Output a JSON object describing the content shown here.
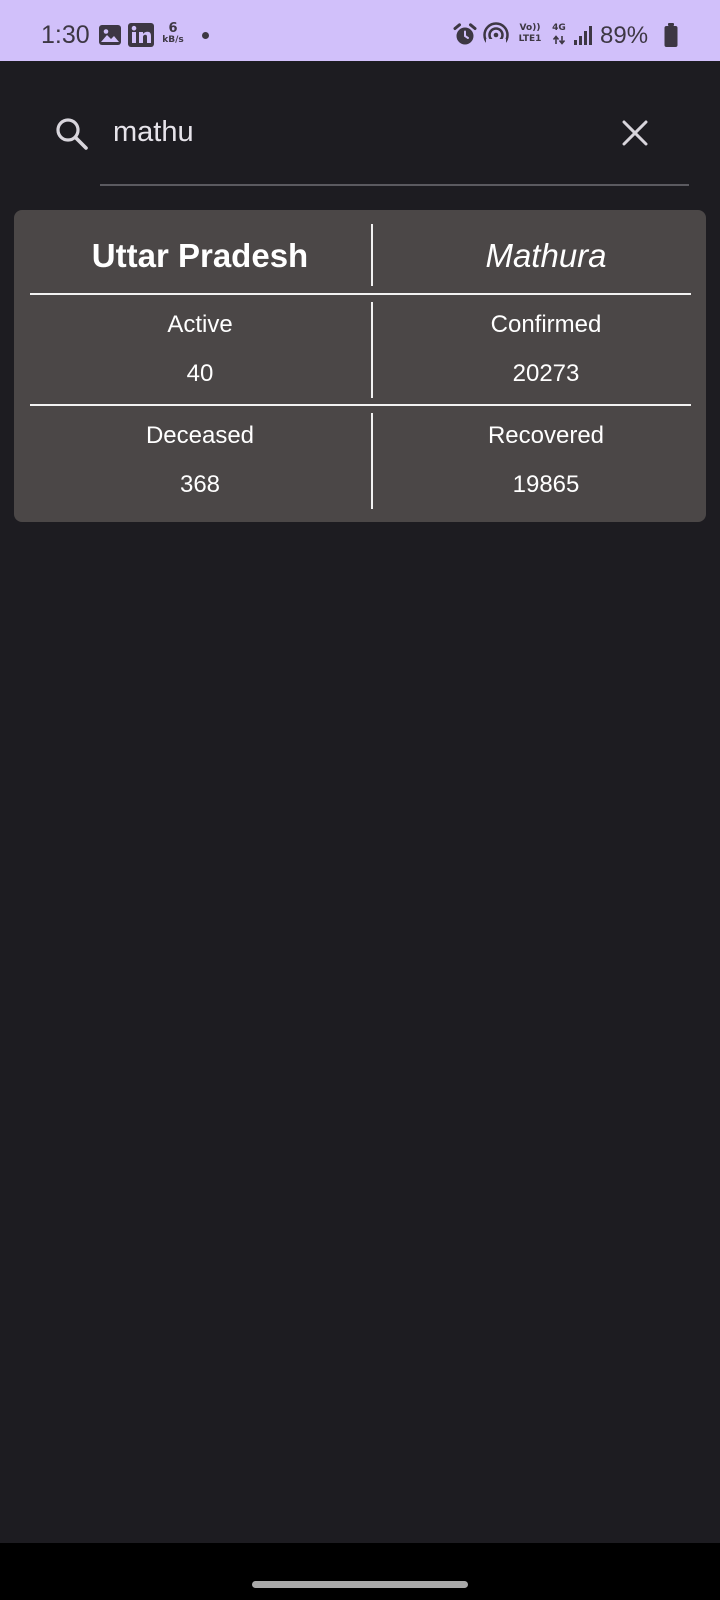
{
  "status_bar": {
    "time": "1:30",
    "net_speed_value": "6",
    "net_speed_unit": "kB/s",
    "volte_line1": "Vo))",
    "volte_line2": "LTE1",
    "network_type": "4G",
    "battery_percent": "89%",
    "icons": [
      "gallery-icon",
      "linkedin-icon",
      "alarm-icon",
      "hotspot-icon",
      "signal-icon",
      "battery-icon"
    ]
  },
  "search": {
    "query": "mathu",
    "icon": "search-icon",
    "clear_icon": "close-icon"
  },
  "result": {
    "state": "Uttar Pradesh",
    "district": "Mathura",
    "stats": {
      "active_label": "Active",
      "active_value": "40",
      "confirmed_label": "Confirmed",
      "confirmed_value": "20273",
      "deceased_label": "Deceased",
      "deceased_value": "368",
      "recovered_label": "Recovered",
      "recovered_value": "19865"
    }
  },
  "colors": {
    "status_bar_bg": "#d1c0fa",
    "app_bg": "#1d1c21",
    "card_bg": "#4b4747",
    "divider": "#f2f2f2"
  }
}
